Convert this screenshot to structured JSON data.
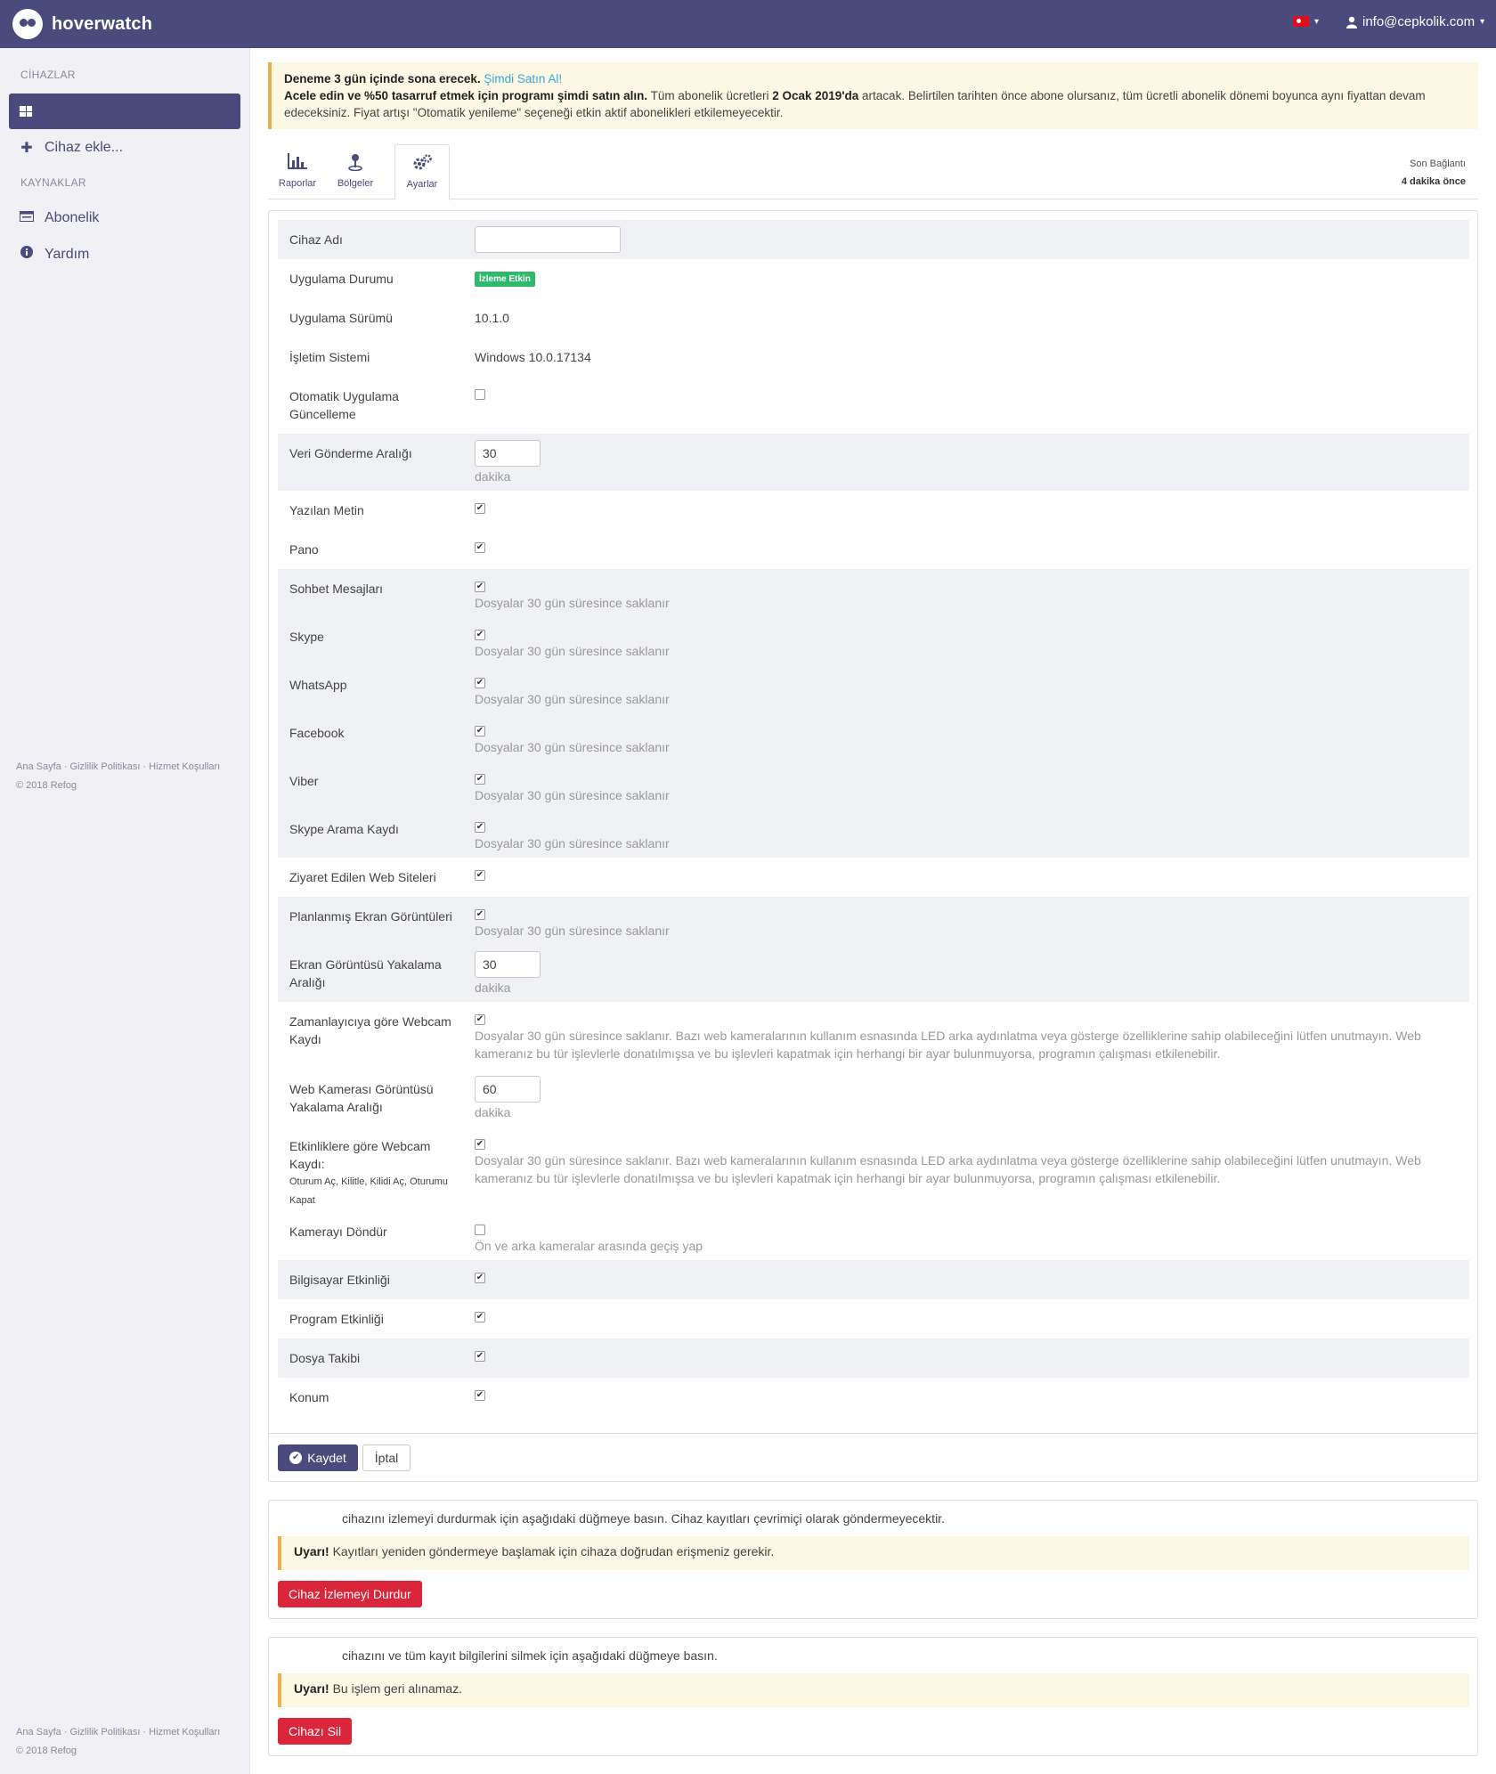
{
  "topbar": {
    "brand": "hoverwatch",
    "user_email": "info@cepkolik.com",
    "caret": "▾"
  },
  "sidebar": {
    "devices_heading": "CİHAZLAR",
    "add_device": "Cihaz ekle...",
    "resources_heading": "KAYNAKLAR",
    "items": [
      {
        "label": "Abonelik",
        "icon": "subscription-icon"
      },
      {
        "label": "Yardım",
        "icon": "info-icon"
      }
    ],
    "footer_links": "Ana Sayfa · Gizlilik Politikası · Hizmet Koşulları",
    "copyright": "© 2018 Refog"
  },
  "alert": {
    "line1_bold": "Deneme 3 gün içinde sona erecek.",
    "line1_link": "Şimdi Satın Al!",
    "line2_bold": "Acele edin ve %50 tasarruf etmek için programı şimdi satın alın.",
    "line2_text_a": "Tüm abonelik ücretleri",
    "line2_date": "2 Ocak 2019'da",
    "line2_text_b": "artacak. Belirtilen tarihten önce abone olursanız, tüm ücretli abonelik dönemi boyunca aynı fiyattan devam edeceksiniz. Fiyat artışı \"Otomatik yenileme\" seçeneği etkin aktif abonelikleri etkilemeyecektir."
  },
  "tabs": [
    {
      "label": "Raporlar",
      "icon": "chart-icon"
    },
    {
      "label": "Bölgeler",
      "icon": "location-icon"
    },
    {
      "label": "Ayarlar",
      "icon": "gears-icon"
    }
  ],
  "last_connection": {
    "label": "Son Bağlantı",
    "value": "4 dakika önce"
  },
  "settings": {
    "device_name_label": "Cihaz Adı",
    "device_name_value": "",
    "app_status_label": "Uygulama Durumu",
    "app_status_badge": "İzleme Etkin",
    "app_version_label": "Uygulama Sürümü",
    "app_version_value": "10.1.0",
    "os_label": "İşletim Sistemi",
    "os_value": "Windows 10.0.17134",
    "auto_update_label": "Otomatik Uygulama Güncelleme",
    "interval_label": "Veri Gönderme Aralığı",
    "interval_value": "30",
    "unit_minutes": "dakika",
    "typed_text_label": "Yazılan Metin",
    "clipboard_label": "Pano",
    "chat_label": "Sohbet Mesajları",
    "skype_label": "Skype",
    "whatsapp_label": "WhatsApp",
    "facebook_label": "Facebook",
    "viber_label": "Viber",
    "skype_call_label": "Skype Arama Kaydı",
    "files_kept_note": "Dosyalar 30 gün süresince saklanır",
    "websites_label": "Ziyaret Edilen Web Siteleri",
    "screenshots_label": "Planlanmış Ekran Görüntüleri",
    "screenshot_interval_label": "Ekran Görüntüsü Yakalama Aralığı",
    "screenshot_interval_value": "30",
    "webcam_timer_label": "Zamanlayıcıya göre Webcam Kaydı",
    "webcam_note": "Dosyalar 30 gün süresince saklanır. Bazı web kameralarının kullanım esnasında LED arka aydınlatma veya gösterge özelliklerine sahip olabileceğini lütfen unutmayın. Web kameranız bu tür işlevlerle donatılmışsa ve bu işlevleri kapatmak için herhangi bir ayar bulunmuyorsa, programın çalışması etkilenebilir.",
    "webcam_interval_label": "Web Kamerası Görüntüsü Yakalama Aralığı",
    "webcam_interval_value": "60",
    "webcam_events_label": "Etkinliklere göre Webcam Kaydı:",
    "webcam_events_small": "Oturum Aç, Kilitle, Kilidi Aç, Oturumu Kapat",
    "rotate_camera_label": "Kamerayı Döndür",
    "rotate_camera_note": "Ön ve arka kameralar arasında geçiş yap",
    "pc_activity_label": "Bilgisayar Etkinliği",
    "program_activity_label": "Program Etkinliği",
    "file_tracking_label": "Dosya Takibi",
    "location_label": "Konum",
    "check": "✔",
    "save": "Kaydet",
    "cancel": "İptal"
  },
  "stop_panel": {
    "text": "cihazını izlemeyi durdurmak için aşağıdaki düğmeye basın. Cihaz kayıtları çevrimiçi olarak göndermeyecektir.",
    "warn_bold": "Uyarı!",
    "warn_text": "Kayıtları yeniden göndermeye başlamak için cihaza doğrudan erişmeniz gerekir.",
    "button": "Cihaz İzlemeyi Durdur"
  },
  "delete_panel": {
    "text": "cihazını ve tüm kayıt bilgilerini silmek için aşağıdaki düğmeye basın.",
    "warn_bold": "Uyarı!",
    "warn_text": "Bu işlem geri alınamaz.",
    "button": "Cihazı Sil"
  },
  "colors": {
    "brand": "#4a4a7c",
    "success": "#2dbb6b",
    "danger": "#d9263b",
    "warning_bg": "#fcf8e3"
  }
}
